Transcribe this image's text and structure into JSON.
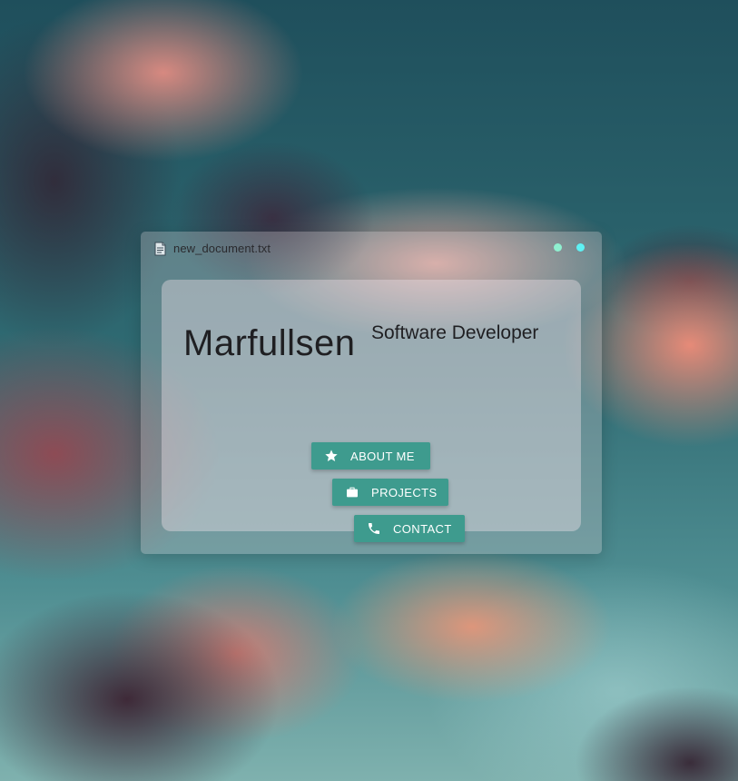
{
  "window": {
    "title": "new_document.txt",
    "file_icon": "document-icon",
    "controls": [
      "minimize-dot",
      "maximize-dot"
    ],
    "control_colors": [
      "#8ff0d0",
      "#5ef1f4"
    ]
  },
  "profile": {
    "name": "Marfullsen",
    "role": "Software Developer"
  },
  "buttons": {
    "about": {
      "label": "ABOUT ME",
      "icon": "star-icon"
    },
    "projects": {
      "label": "PROJECTS",
      "icon": "briefcase-icon"
    },
    "contact": {
      "label": "CONTACT",
      "icon": "phone-icon"
    }
  },
  "colors": {
    "accent": "#3e9b8e",
    "text": "#1f1f22"
  }
}
